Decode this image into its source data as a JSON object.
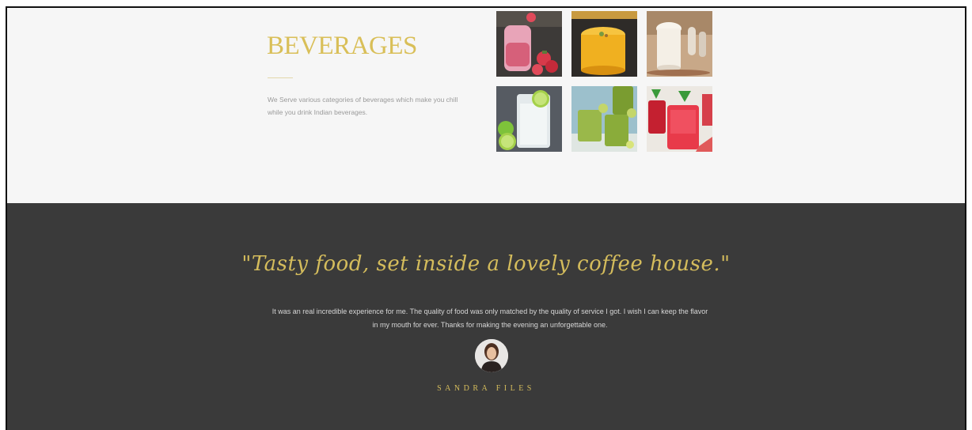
{
  "beverages": {
    "title": "BEVERAGES",
    "description": "We Serve various categories of beverages which make you chill while you drink Indian beverages.",
    "images": [
      {
        "name": "strawberry-smoothie-image",
        "colors": [
          "#3a3a3a",
          "#e8a4b8",
          "#d83a4a",
          "#5a7a3a"
        ]
      },
      {
        "name": "mango-lassi-image",
        "colors": [
          "#3a3530",
          "#f0b020",
          "#e89a10",
          "#8a7a40"
        ]
      },
      {
        "name": "sweet-lassi-image",
        "colors": [
          "#c9a98a",
          "#f4efe6",
          "#a07050",
          "#6a4a30"
        ]
      },
      {
        "name": "lime-soda-image",
        "colors": [
          "#5a5f66",
          "#e8eef0",
          "#7ec23a",
          "#a4d04a"
        ]
      },
      {
        "name": "green-juice-image",
        "colors": [
          "#8ab4c0",
          "#9ab84a",
          "#c4d66a",
          "#eef2ea"
        ]
      },
      {
        "name": "watermelon-drink-image",
        "colors": [
          "#eae6e0",
          "#e83a4a",
          "#c42030",
          "#3a9a3a"
        ]
      }
    ]
  },
  "testimonial": {
    "quote": "\"Tasty food, set inside a lovely coffee house.\"",
    "text": "It was an real incredible experience for me. The quality of food was only matched by the quality of service I got. I wish I can keep the flavor in my mouth for ever. Thanks for making the evening an unforgettable one.",
    "author": "SANDRA FILES"
  },
  "colors": {
    "accent": "#d4bc5c",
    "dark_bg": "#3a3a3a",
    "light_bg": "#f6f6f6"
  }
}
